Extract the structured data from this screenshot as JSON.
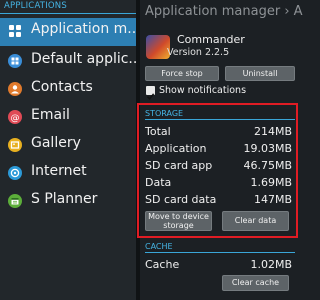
{
  "left": {
    "header": "APPLICATIONS",
    "items": [
      {
        "label": "Application m..",
        "icon": "grid-icon",
        "color": "#ffffff",
        "selected": true
      },
      {
        "label": "Default applic..",
        "icon": "grid-icon",
        "color": "#3a8ed8",
        "selected": false
      },
      {
        "label": "Contacts",
        "icon": "contact-icon",
        "color": "#e07a2c",
        "selected": false
      },
      {
        "label": "Email",
        "icon": "email-icon",
        "color": "#e04a56",
        "selected": false
      },
      {
        "label": "Gallery",
        "icon": "gallery-icon",
        "color": "#e8b020",
        "selected": false
      },
      {
        "label": "Internet",
        "icon": "internet-icon",
        "color": "#2c9ad8",
        "selected": false
      },
      {
        "label": "S Planner",
        "icon": "planner-icon",
        "color": "#5cae3a",
        "selected": false
      }
    ]
  },
  "right": {
    "title": "Application manager › A",
    "app": {
      "name": "Commander",
      "version": "Version 2.2.5"
    },
    "buttons": {
      "force_stop": "Force stop",
      "uninstall": "Uninstall"
    },
    "show_notifications": {
      "label": "Show notifications",
      "checked": true
    },
    "storage": {
      "title": "STORAGE",
      "rows": [
        {
          "label": "Total",
          "value": "214MB"
        },
        {
          "label": "Application",
          "value": "19.03MB"
        },
        {
          "label": "SD card app",
          "value": "46.75MB"
        },
        {
          "label": "Data",
          "value": "1.69MB"
        },
        {
          "label": "SD card data",
          "value": "147MB"
        }
      ],
      "move_button": "Move to device storage",
      "clear_data_button": "Clear data"
    },
    "cache": {
      "title": "CACHE",
      "label": "Cache",
      "value": "1.02MB",
      "clear_cache_button": "Clear cache"
    }
  },
  "colors": {
    "accent": "#45b4e4",
    "selected": "#2d7fb3",
    "highlight": "#e01c24"
  }
}
